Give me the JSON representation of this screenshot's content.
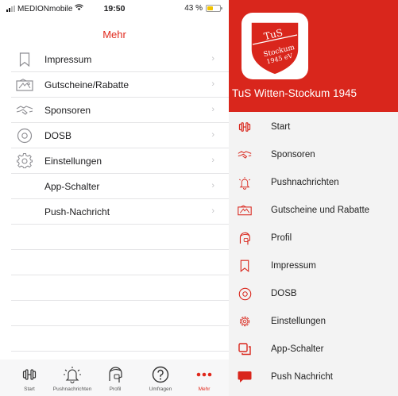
{
  "ios": {
    "status_bar": {
      "carrier": "MEDIONmobile",
      "time": "19:50",
      "battery": "43 %",
      "battery_level": 0.43
    },
    "title": "Mehr",
    "menu": [
      {
        "label": "Impressum",
        "icon": "bookmark-icon"
      },
      {
        "label": "Gutscheine/Rabatte",
        "icon": "voucher-icon"
      },
      {
        "label": "Sponsoren",
        "icon": "handshake-icon"
      },
      {
        "label": "DOSB",
        "icon": "dosb-circle-icon"
      },
      {
        "label": "Einstellungen",
        "icon": "gear-icon"
      },
      {
        "label": "App-Schalter",
        "icon": ""
      },
      {
        "label": "Push-Nachricht",
        "icon": ""
      }
    ],
    "tabs": [
      {
        "label": "Start",
        "icon": "dumbbell-icon"
      },
      {
        "label": "Pushnachrichten",
        "icon": "bell-icon"
      },
      {
        "label": "Profil",
        "icon": "profile-head-icon"
      },
      {
        "label": "Umfragen",
        "icon": "question-icon"
      },
      {
        "label": "Mehr",
        "icon": "more-dots-icon"
      }
    ],
    "accent_color": "#e0281c"
  },
  "android": {
    "logo": {
      "line1": "TuS",
      "line2": "Stockum",
      "line3": "1945 eV"
    },
    "club_name": "TuS Witten-Stockum 1945",
    "header_color": "#d9261c",
    "menu": [
      {
        "label": "Start",
        "icon": "dumbbell-icon"
      },
      {
        "label": "Sponsoren",
        "icon": "handshake-icon"
      },
      {
        "label": "Pushnachrichten",
        "icon": "bell-icon"
      },
      {
        "label": "Gutscheine und Rabatte",
        "icon": "voucher-icon"
      },
      {
        "label": "Profil",
        "icon": "profile-head-icon"
      },
      {
        "label": "Impressum",
        "icon": "bookmark-icon"
      },
      {
        "label": "DOSB",
        "icon": "dosb-circle-icon"
      },
      {
        "label": "Einstellungen",
        "icon": "gear-icon"
      },
      {
        "label": "App-Schalter",
        "icon": "app-switch-icon"
      },
      {
        "label": "Push Nachricht",
        "icon": "chat-bubble-icon"
      }
    ]
  }
}
